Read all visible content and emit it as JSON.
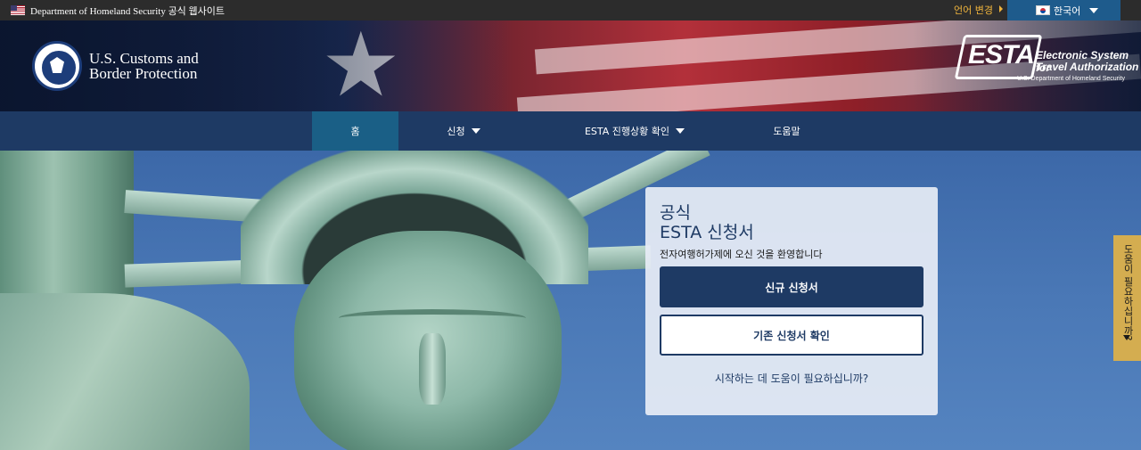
{
  "topbar": {
    "official_site": "Department of Homeland Security 공식 웹사이트",
    "language_change": "언어 변경",
    "current_language": "한국어"
  },
  "header": {
    "agency_line1": "U.S. Customs and",
    "agency_line2": "Border Protection",
    "esta_logo": "ESTA",
    "esta_full_line1": "Electronic System for",
    "esta_full_line2": "Travel Authorization",
    "esta_dhs": "U.S. Department of Homeland Security"
  },
  "nav": {
    "items": [
      {
        "label": "홈"
      },
      {
        "label": "신청"
      },
      {
        "label": "ESTA 진행상황 확인"
      },
      {
        "label": "도움말"
      }
    ]
  },
  "card": {
    "title_line1": "공식",
    "title_line2": "ESTA 신청서",
    "welcome": "전자여행허가제에 오신 것을 환영합니다",
    "new_application": "신규 신청서",
    "existing_application": "기존 신청서 확인",
    "help_start": "시작하는 데 도움이 필요하십니까?"
  },
  "side_help": {
    "label": "도움이 필요하십니까?"
  },
  "colors": {
    "nav_bg": "#1e3a64",
    "nav_active": "#1a5f86",
    "accent_gold": "#d4ad50",
    "primary_button": "#1e3a64"
  }
}
